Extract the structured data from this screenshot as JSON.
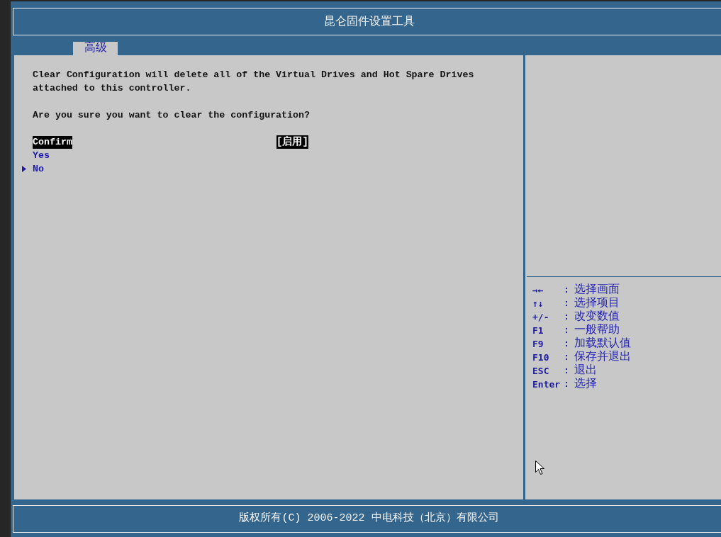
{
  "window": {
    "title": "昆仑固件设置工具"
  },
  "tabs": [
    {
      "label": "高级",
      "selected": true
    }
  ],
  "message": "Clear Configuration will delete all of the Virtual Drives and Hot Spare Drives attached to this controller.",
  "question": "Are you sure you want to clear the configuration?",
  "options": [
    {
      "kind": "setting",
      "label": "Confirm",
      "value": "[启用]",
      "selected": true,
      "submenu": false
    },
    {
      "kind": "choice",
      "label": "Yes",
      "selected": false,
      "submenu": false
    },
    {
      "kind": "choice",
      "label": "No",
      "selected": false,
      "submenu": true
    }
  ],
  "help": [
    {
      "key": "→←",
      "separator": ":",
      "description": "选择画面"
    },
    {
      "key": "↑↓",
      "separator": ":",
      "description": "选择项目"
    },
    {
      "key": "+/-",
      "separator": ":",
      "description": "改变数值"
    },
    {
      "key": "F1",
      "separator": ":",
      "description": "一般帮助"
    },
    {
      "key": "F9",
      "separator": ":",
      "description": "加载默认值"
    },
    {
      "key": "F10",
      "separator": ":",
      "description": "保存并退出"
    },
    {
      "key": "ESC",
      "separator": ":",
      "description": "退出"
    },
    {
      "key": "Enter",
      "separator": ":",
      "description": "选择"
    }
  ],
  "footer": {
    "copyright": "版权所有(C) 2006-2022 中电科技（北京）有限公司"
  }
}
